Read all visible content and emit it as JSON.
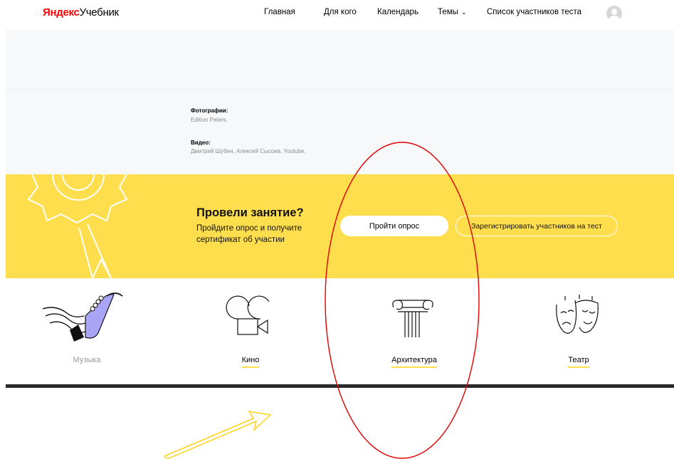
{
  "header": {
    "logo_brand": "Яндекс",
    "logo_product": "Учебник",
    "nav": [
      {
        "label": "Главная"
      },
      {
        "label": "Для кого"
      },
      {
        "label": "Календарь"
      },
      {
        "label": "Темы"
      },
      {
        "label": "Список участников теста"
      }
    ]
  },
  "credits": {
    "photos_label": "Фотографии:",
    "photos_value": "Edition Peters.",
    "video_label": "Видео:",
    "video_value": "Дмитрий Шубин, Алексей Сысоев, Youtube."
  },
  "cta": {
    "title": "Провели занятие?",
    "text": "Пройдите опрос и получите сертификат об участии",
    "survey_button": "Пройти опрос",
    "register_button": "Зарегистрировать участников на тест"
  },
  "topics": [
    {
      "label": "Музыка",
      "icon": "saxophone-icon",
      "active": false
    },
    {
      "label": "Кино",
      "icon": "film-camera-icon",
      "active": true
    },
    {
      "label": "Архитектура",
      "icon": "ionic-column-icon",
      "active": true
    },
    {
      "label": "Театр",
      "icon": "theatre-masks-icon",
      "active": true
    }
  ],
  "colors": {
    "accent_yellow": "#ffde4d",
    "annotation_red": "#e00000",
    "saxophone_violet": "#a9a4f5"
  }
}
